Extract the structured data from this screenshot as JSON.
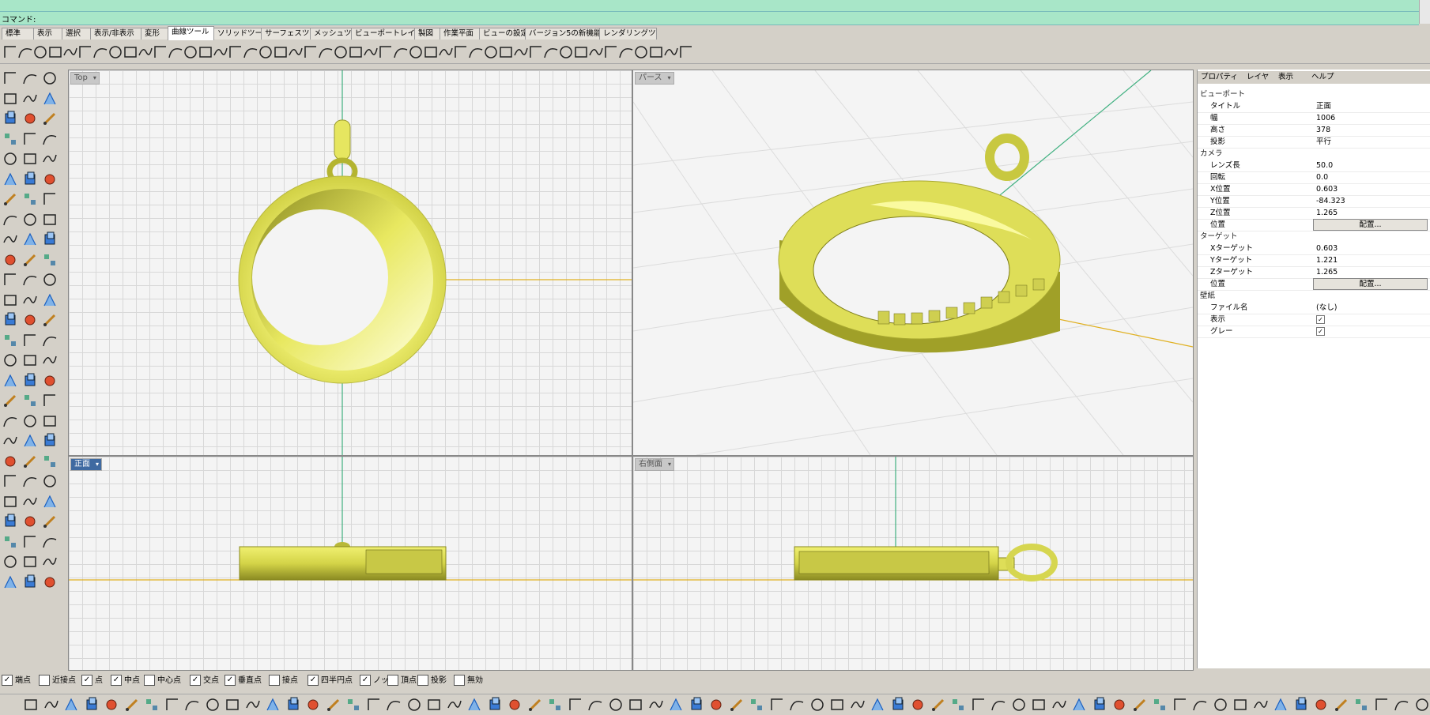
{
  "command": {
    "prompt": "コマンド:"
  },
  "tabs": [
    "標準",
    "表示",
    "選択",
    "表示/非表示",
    "変形",
    "曲線ツール",
    "ソリッドツール",
    "サーフェスツール",
    "メッシュツール",
    "ビューポートレイアウト",
    "製図",
    "作業平面",
    "ビューの設定",
    "バージョン5の新機能",
    "レンダリングツール"
  ],
  "active_tab": "曲線ツール",
  "viewports": {
    "top": {
      "title": "Top"
    },
    "perspective": {
      "title": "パース"
    },
    "front": {
      "title": "正面"
    },
    "right": {
      "title": "右側面"
    }
  },
  "properties": {
    "tabs": [
      "プロパティ",
      "レイヤ",
      "表示",
      "ヘルプ"
    ],
    "sections": {
      "viewport": "ビューポート",
      "camera": "カメラ",
      "target": "ターゲット",
      "wallpaper": "壁紙"
    },
    "viewport_rows": [
      {
        "key": "タイトル",
        "value": "正面"
      },
      {
        "key": "幅",
        "value": "1006"
      },
      {
        "key": "高さ",
        "value": "378"
      },
      {
        "key": "投影",
        "value": "平行"
      }
    ],
    "camera_rows": [
      {
        "key": "レンズ長",
        "value": "50.0"
      },
      {
        "key": "回転",
        "value": "0.0"
      },
      {
        "key": "X位置",
        "value": "0.603"
      },
      {
        "key": "Y位置",
        "value": "-84.323"
      },
      {
        "key": "Z位置",
        "value": "1.265"
      },
      {
        "key": "位置",
        "value": "配置..."
      }
    ],
    "target_rows": [
      {
        "key": "Xターゲット",
        "value": "0.603"
      },
      {
        "key": "Yターゲット",
        "value": "1.221"
      },
      {
        "key": "Zターゲット",
        "value": "1.265"
      },
      {
        "key": "位置",
        "value": "配置..."
      }
    ],
    "wallpaper_rows": [
      {
        "key": "ファイル名",
        "value": "(なし)"
      },
      {
        "key": "表示",
        "value": "✓"
      },
      {
        "key": "グレー",
        "value": "✓"
      }
    ]
  },
  "osnaps": [
    {
      "label": "端点",
      "checked": true
    },
    {
      "label": "近接点",
      "checked": false
    },
    {
      "label": "点",
      "checked": true
    },
    {
      "label": "中点",
      "checked": true
    },
    {
      "label": "中心点",
      "checked": false
    },
    {
      "label": "交点",
      "checked": true
    },
    {
      "label": "垂直点",
      "checked": true
    },
    {
      "label": "接点",
      "checked": false
    },
    {
      "label": "四半円点",
      "checked": true
    },
    {
      "label": "ノット",
      "checked": true
    },
    {
      "label": "頂点",
      "checked": false
    },
    {
      "label": "投影",
      "checked": false
    },
    {
      "label": "無効",
      "checked": false
    }
  ],
  "colors": {
    "command_bg": "#a8e6c8",
    "model_yellow": "#d8d84a",
    "x_axis": "#e0b020",
    "y_axis": "#40b080",
    "active_viewport_title": "#3f6aa1"
  }
}
